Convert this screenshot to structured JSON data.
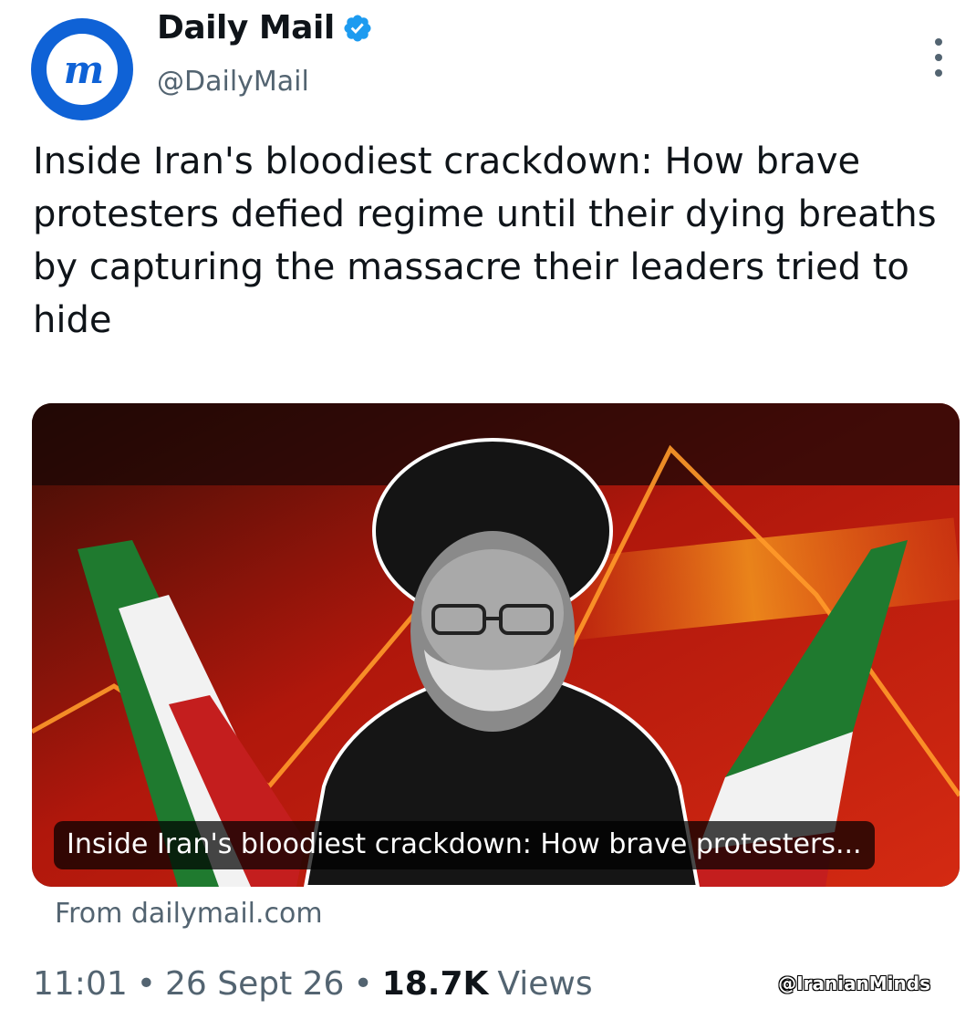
{
  "account": {
    "display_name": "Daily Mail",
    "handle": "@DailyMail",
    "avatar_letters": "m",
    "verified": true,
    "brand_color": "#0f62d6",
    "verified_color": "#1d9bf0"
  },
  "tweet": {
    "text": "Inside Iran's bloodiest crackdown: How brave protesters defied regime until their dying breaths by capturing the massacre their leaders tried to hide"
  },
  "link_card": {
    "caption": "Inside Iran's bloodiest crackdown: How brave protesters...",
    "source": "From dailymail.com"
  },
  "meta": {
    "time": "11:01",
    "date": "26 Sept 26",
    "views_count": "18.7K",
    "views_label": "Views"
  },
  "watermark": "@IranianMinds",
  "icons": {
    "more": "more-vertical-icon",
    "verified": "verified-badge-icon"
  }
}
